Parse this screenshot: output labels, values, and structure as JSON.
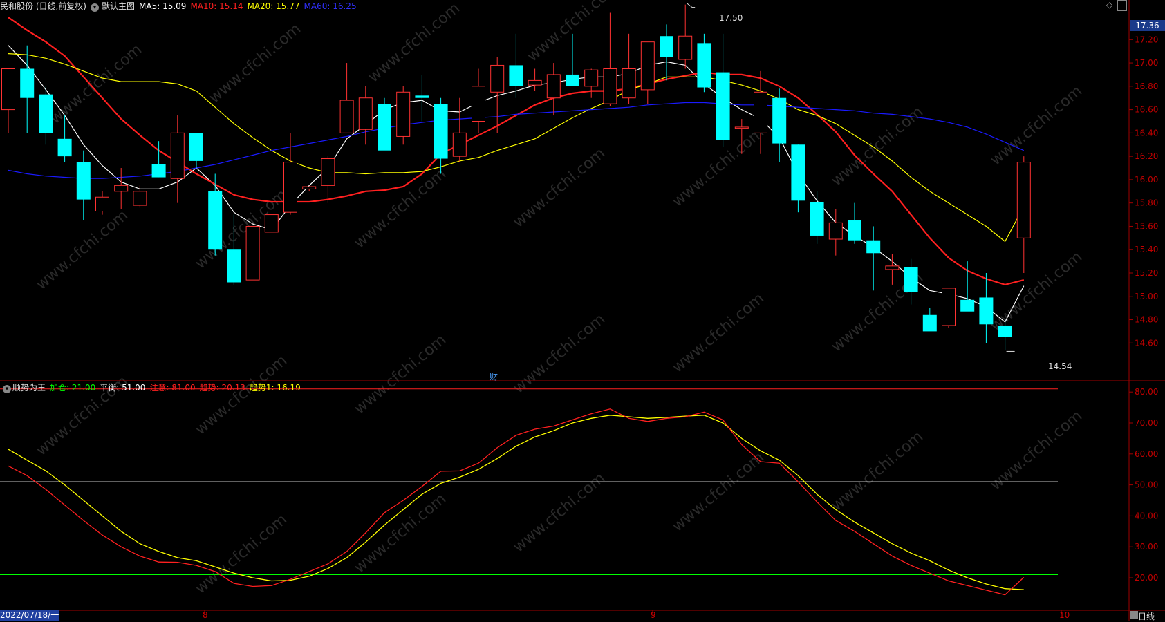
{
  "title_bar": {
    "stock": "民和股份 (日线,前复权)",
    "template": "默认主图",
    "ma5": "MA5: 15.09",
    "ma10": "MA10: 15.14",
    "ma20": "MA20: 15.77",
    "ma60": "MA60: 16.25"
  },
  "indicator_bar": {
    "name": "顺势为王",
    "jiacang": "加仓: 21.00",
    "pingheng": "平衡: 51.00",
    "zhuyi": "注意: 81.00",
    "qushi": "趋势: 20.13",
    "qushi1": "趋势1: 16.19"
  },
  "price_axis_labels": [
    "17.20",
    "17.00",
    "16.80",
    "16.60",
    "16.40",
    "16.20",
    "16.00",
    "15.80",
    "15.60",
    "15.40",
    "15.20",
    "15.00",
    "14.80",
    "14.60"
  ],
  "current_price_tag": "17.36",
  "max_label": "17.50",
  "min_label": "14.54",
  "cai_marker": "财",
  "indicator_axis_labels": [
    "80.00",
    "70.00",
    "60.00",
    "50.00",
    "40.00",
    "30.00",
    "20.00"
  ],
  "x_labels": {
    "start": "2022/07/18/一",
    "aug": "8",
    "sep": "9",
    "oct": "10"
  },
  "period": "日线",
  "watermark": "www.cfchi.com",
  "colors": {
    "up": "#ff3232",
    "down": "#00ffff",
    "ma5": "#ffffff",
    "ma10": "#ff2020",
    "ma20": "#ffff00",
    "ma60": "#1a1aff",
    "qushi": "#ff2020",
    "qushi1": "#ffff00",
    "axis": "#a00000",
    "jiacang_line": "#00ff00",
    "pingheng_line": "#ffffff",
    "zhuyi_line": "#ff2020"
  },
  "chart_data": {
    "type": "candlestick",
    "ohlc": [
      [
        16.6,
        16.95,
        16.4,
        16.95
      ],
      [
        16.95,
        17.15,
        16.4,
        16.7
      ],
      [
        16.73,
        16.8,
        16.3,
        16.4
      ],
      [
        16.35,
        16.55,
        16.15,
        16.2
      ],
      [
        16.15,
        16.25,
        15.65,
        15.83
      ],
      [
        15.73,
        15.9,
        15.7,
        15.85
      ],
      [
        15.9,
        16.1,
        15.75,
        15.95
      ],
      [
        15.78,
        15.95,
        15.76,
        15.9
      ],
      [
        16.13,
        16.33,
        16.02,
        16.02
      ],
      [
        16.01,
        16.55,
        15.8,
        16.4
      ],
      [
        16.4,
        16.4,
        16.1,
        16.16
      ],
      [
        15.9,
        16.05,
        15.35,
        15.4
      ],
      [
        15.4,
        15.7,
        15.1,
        15.12
      ],
      [
        15.14,
        15.6,
        15.14,
        15.6
      ],
      [
        15.55,
        15.7,
        15.55,
        15.7
      ],
      [
        15.72,
        16.4,
        15.7,
        16.15
      ],
      [
        15.92,
        15.94,
        15.9,
        15.94
      ],
      [
        15.95,
        16.2,
        15.8,
        16.18
      ],
      [
        16.4,
        17.0,
        16.4,
        16.68
      ],
      [
        16.43,
        16.8,
        16.3,
        16.7
      ],
      [
        16.65,
        16.7,
        16.3,
        16.25
      ],
      [
        16.37,
        16.8,
        16.3,
        16.75
      ],
      [
        16.72,
        16.9,
        16.5,
        16.7
      ],
      [
        16.65,
        16.7,
        16.05,
        16.18
      ],
      [
        16.2,
        16.7,
        16.15,
        16.4
      ],
      [
        16.5,
        16.95,
        16.4,
        16.8
      ],
      [
        16.75,
        17.05,
        16.4,
        16.98
      ],
      [
        16.98,
        17.25,
        16.7,
        16.8
      ],
      [
        16.81,
        16.95,
        16.76,
        16.85
      ],
      [
        16.7,
        17.0,
        16.55,
        16.9
      ],
      [
        16.9,
        17.25,
        16.8,
        16.8
      ],
      [
        16.8,
        16.95,
        16.7,
        16.94
      ],
      [
        16.65,
        17.43,
        16.63,
        16.95
      ],
      [
        16.7,
        17.25,
        16.65,
        16.95
      ],
      [
        16.77,
        17.12,
        16.65,
        17.18
      ],
      [
        17.23,
        17.33,
        16.85,
        17.05
      ],
      [
        17.03,
        17.5,
        16.95,
        17.23
      ],
      [
        17.17,
        17.25,
        16.75,
        16.79
      ],
      [
        16.92,
        17.25,
        16.28,
        16.34
      ],
      [
        16.44,
        16.52,
        16.22,
        16.45
      ],
      [
        16.4,
        16.93,
        16.22,
        16.75
      ],
      [
        16.7,
        16.78,
        16.15,
        16.31
      ],
      [
        16.3,
        16.3,
        15.72,
        15.82
      ],
      [
        15.81,
        15.9,
        15.45,
        15.52
      ],
      [
        15.49,
        15.75,
        15.35,
        15.63
      ],
      [
        15.65,
        15.8,
        15.45,
        15.48
      ],
      [
        15.48,
        15.6,
        15.05,
        15.37
      ],
      [
        15.23,
        15.36,
        15.1,
        15.26
      ],
      [
        15.25,
        15.32,
        14.93,
        15.04
      ],
      [
        14.84,
        14.9,
        14.72,
        14.7
      ],
      [
        14.75,
        15.07,
        14.73,
        15.07
      ],
      [
        14.97,
        15.3,
        14.9,
        14.87
      ],
      [
        14.99,
        15.2,
        14.6,
        14.76
      ],
      [
        14.75,
        14.8,
        14.54,
        14.65
      ],
      [
        15.5,
        16.2,
        15.2,
        16.15
      ]
    ],
    "series": [
      {
        "name": "MA5",
        "values": [
          17.15,
          16.98,
          16.77,
          16.55,
          16.3,
          16.12,
          15.98,
          15.92,
          15.92,
          15.98,
          16.1,
          15.95,
          15.72,
          15.62,
          15.57,
          15.78,
          15.95,
          16.1,
          16.35,
          16.47,
          16.6,
          16.66,
          16.68,
          16.59,
          16.58,
          16.66,
          16.72,
          16.76,
          16.81,
          16.83,
          16.86,
          16.88,
          16.88,
          16.91,
          16.98,
          17.01,
          16.98,
          16.82,
          16.7,
          16.6,
          16.52,
          16.36,
          16.05,
          15.82,
          15.63,
          15.52,
          15.42,
          15.3,
          15.16,
          15.05,
          15.02,
          14.98,
          14.91,
          14.78,
          15.09
        ]
      },
      {
        "name": "MA10",
        "values": [
          17.39,
          17.28,
          17.18,
          17.06,
          16.88,
          16.7,
          16.52,
          16.38,
          16.25,
          16.15,
          16.05,
          15.96,
          15.87,
          15.83,
          15.81,
          15.81,
          15.81,
          15.83,
          15.86,
          15.9,
          15.91,
          15.94,
          16.05,
          16.22,
          16.3,
          16.38,
          16.46,
          16.55,
          16.64,
          16.7,
          16.74,
          16.76,
          16.76,
          16.78,
          16.82,
          16.86,
          16.89,
          16.92,
          16.9,
          16.9,
          16.87,
          16.8,
          16.7,
          16.56,
          16.41,
          16.21,
          16.05,
          15.9,
          15.7,
          15.5,
          15.33,
          15.22,
          15.15,
          15.1,
          15.14
        ]
      },
      {
        "name": "MA20",
        "values": [
          17.08,
          17.07,
          17.04,
          16.99,
          16.93,
          16.87,
          16.84,
          16.84,
          16.84,
          16.82,
          16.76,
          16.62,
          16.48,
          16.36,
          16.25,
          16.16,
          16.1,
          16.06,
          16.06,
          16.05,
          16.06,
          16.06,
          16.07,
          16.11,
          16.16,
          16.19,
          16.25,
          16.3,
          16.35,
          16.44,
          16.53,
          16.61,
          16.68,
          16.77,
          16.82,
          16.88,
          16.88,
          16.88,
          16.85,
          16.81,
          16.76,
          16.69,
          16.6,
          16.55,
          16.48,
          16.38,
          16.28,
          16.16,
          16.02,
          15.9,
          15.8,
          15.7,
          15.6,
          15.47,
          15.77
        ]
      },
      {
        "name": "MA60",
        "values": [
          16.08,
          16.05,
          16.03,
          16.02,
          16.01,
          16.01,
          16.02,
          16.03,
          16.05,
          16.07,
          16.1,
          16.13,
          16.17,
          16.21,
          16.25,
          16.28,
          16.31,
          16.34,
          16.37,
          16.41,
          16.44,
          16.47,
          16.49,
          16.51,
          16.52,
          16.53,
          16.54,
          16.56,
          16.57,
          16.58,
          16.59,
          16.6,
          16.61,
          16.62,
          16.64,
          16.65,
          16.66,
          16.66,
          16.65,
          16.64,
          16.64,
          16.63,
          16.62,
          16.61,
          16.6,
          16.59,
          16.57,
          16.56,
          16.54,
          16.52,
          16.49,
          16.45,
          16.39,
          16.32,
          16.25
        ]
      }
    ],
    "indicator": {
      "name": "顺势为王",
      "levels": {
        "加仓": 21.0,
        "平衡": 51.0,
        "注意": 81.0
      },
      "qushi": [
        56.1,
        53.0,
        48.5,
        43.5,
        38.5,
        33.8,
        30.0,
        27.0,
        25.1,
        25.0,
        24.0,
        22.0,
        18.2,
        17.2,
        17.5,
        19.5,
        22.0,
        24.5,
        28.5,
        34.5,
        41.0,
        45.0,
        49.5,
        54.4,
        54.5,
        57.0,
        62.0,
        66.0,
        68.0,
        69.0,
        71.0,
        73.0,
        74.5,
        71.5,
        70.5,
        71.5,
        72.0,
        73.5,
        71.0,
        63.0,
        57.5,
        57.0,
        51.0,
        44.5,
        38.5,
        35.0,
        31.0,
        27.0,
        24.0,
        21.5,
        19.0,
        17.5,
        16.0,
        14.5,
        20.13
      ],
      "qushi1": [
        61.5,
        58.0,
        54.5,
        50.0,
        45.0,
        40.0,
        35.0,
        31.0,
        28.5,
        26.5,
        25.5,
        23.5,
        21.5,
        20.0,
        19.0,
        19.2,
        20.5,
        23.0,
        26.5,
        31.5,
        37.0,
        42.0,
        47.0,
        50.5,
        52.5,
        55.0,
        58.5,
        62.5,
        65.5,
        67.5,
        70.0,
        71.5,
        72.5,
        72.0,
        71.5,
        71.8,
        72.2,
        72.5,
        70.0,
        65.0,
        61.0,
        58.0,
        53.0,
        47.0,
        42.0,
        38.0,
        34.5,
        31.0,
        28.0,
        25.5,
        22.5,
        20.0,
        18.0,
        16.5,
        16.19
      ]
    }
  }
}
